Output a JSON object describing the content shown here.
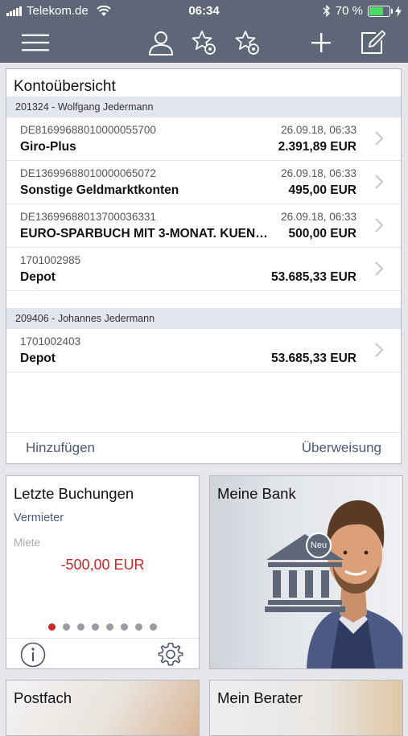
{
  "status": {
    "carrier": "Telekom.de",
    "time": "06:34",
    "battery": "70 %"
  },
  "nav": {
    "icons": [
      "menu-icon",
      "profile-icon",
      "favorite-settings-icon",
      "favorite-config-icon",
      "add-icon",
      "edit-icon"
    ]
  },
  "overview": {
    "title": "Kontoübersicht",
    "groups": [
      {
        "header": "201324 - Wolfgang Jedermann",
        "accounts": [
          {
            "number": "DE81699688010000055700",
            "date": "26.09.18, 06:33",
            "name": "Giro-Plus",
            "amount": "2.391,89 EUR"
          },
          {
            "number": "DE13699688010000065072",
            "date": "26.09.18, 06:33",
            "name": "Sonstige Geldmarktkonten",
            "amount": "495,00 EUR"
          },
          {
            "number": "DE13699688013700036331",
            "date": "26.09.18, 06:33",
            "name": "EURO-SPARBUCH MIT 3-MONAT. KUEN…",
            "amount": "500,00 EUR"
          },
          {
            "number": "1701002985",
            "date": "",
            "name": "Depot",
            "amount": "53.685,33 EUR"
          }
        ]
      },
      {
        "header": "209406 - Johannes Jedermann",
        "accounts": [
          {
            "number": "1701002403",
            "date": "",
            "name": "Depot",
            "amount": "53.685,33 EUR"
          }
        ]
      }
    ],
    "add_label": "Hinzufügen",
    "transfer_label": "Überweisung"
  },
  "tiles": {
    "bookings": {
      "title": "Letzte Buchungen",
      "counterparty": "Vermieter",
      "purpose": "Miete",
      "amount": "-500,00 EUR",
      "page_count": 8,
      "active_page": 1
    },
    "bank": {
      "title": "Meine Bank",
      "badge": "Neu"
    },
    "mailbox": {
      "title": "Postfach"
    },
    "advisor": {
      "title": "Mein Berater"
    }
  },
  "colors": {
    "bar": "#5d6777",
    "accent": "#4b5a78",
    "negative": "#c8282a",
    "active_dot": "#c8282a"
  }
}
